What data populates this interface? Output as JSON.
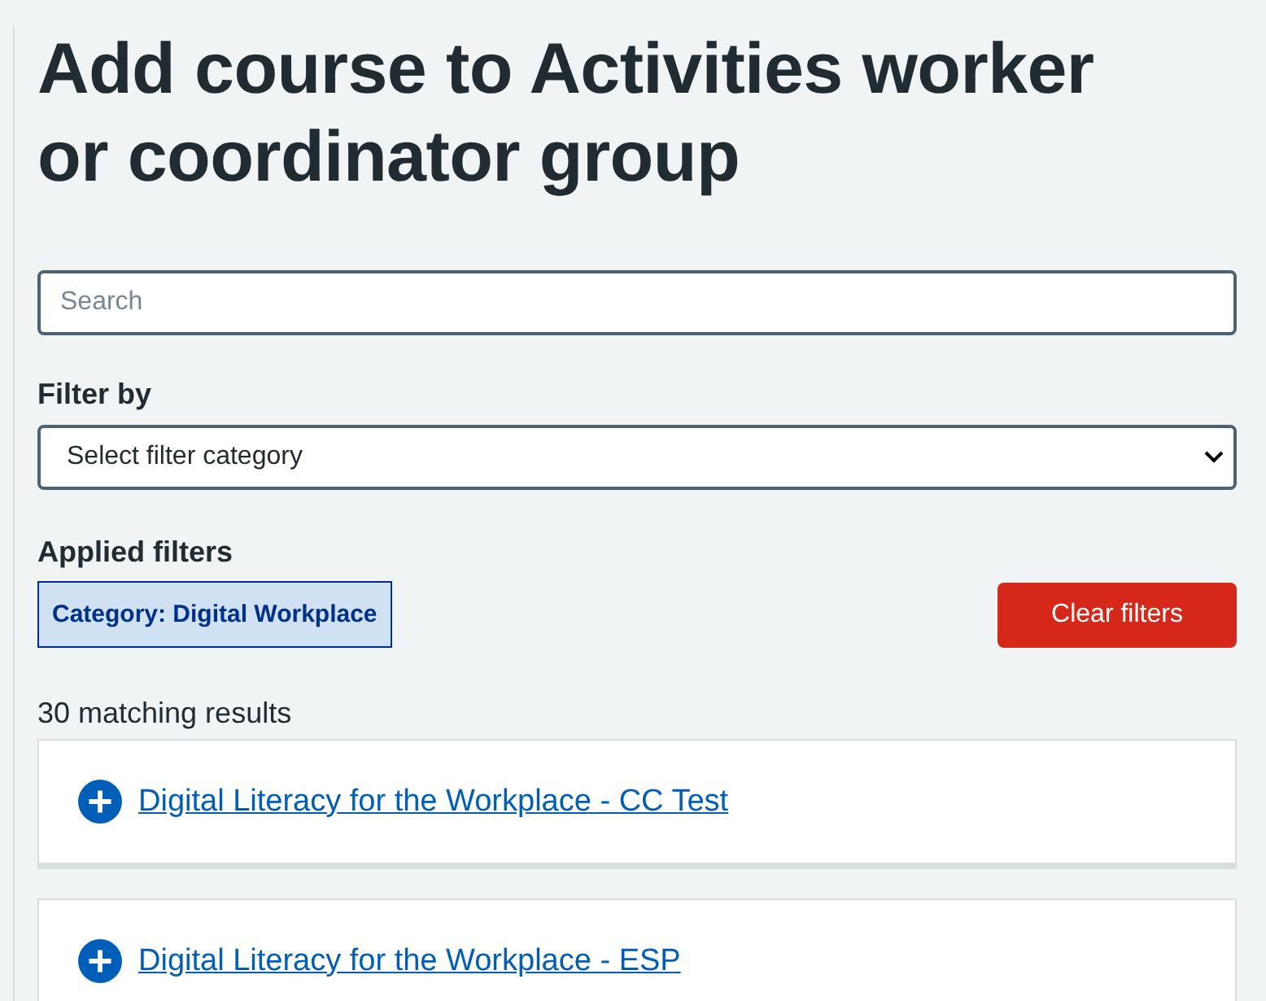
{
  "title": "Add course to Activities worker or coordinator group",
  "search": {
    "placeholder": "Search"
  },
  "filter": {
    "label": "Filter by",
    "value": "Select filter category"
  },
  "applied_filters": {
    "heading": "Applied filters",
    "tags": [
      "Category: Digital Workplace"
    ],
    "clear_button": "Clear filters"
  },
  "results_count": "30 matching results",
  "results": [
    {
      "title": "Digital Literacy for the Workplace - CC Test"
    },
    {
      "title": "Digital Literacy for the Workplace - ESP"
    }
  ]
}
